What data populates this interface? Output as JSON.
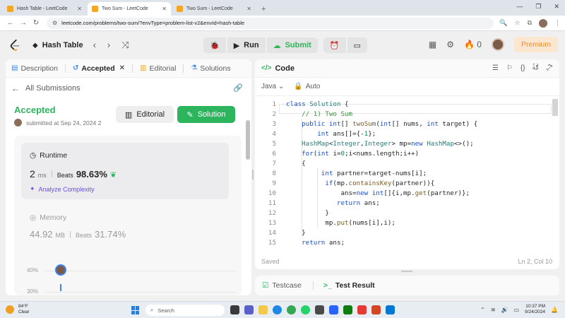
{
  "browser": {
    "tabs": [
      {
        "title": "Hash Table - LeetCode",
        "active": false
      },
      {
        "title": "Two Sum - LeetCode",
        "active": true
      },
      {
        "title": "Two Sum - LeetCode",
        "active": false
      }
    ],
    "url": "leetcode.com/problems/two-sum/?envType=problem-list-v2&envId=hash-table"
  },
  "header": {
    "problem_list": "Hash Table",
    "run_label": "Run",
    "submit_label": "Submit",
    "streak_count": "0",
    "premium_label": "Premium"
  },
  "left_panel": {
    "tabs": [
      {
        "label": "Description"
      },
      {
        "label": "Accepted"
      },
      {
        "label": "Editorial"
      },
      {
        "label": "Solutions"
      }
    ],
    "all_submissions": "All Submissions",
    "status": "Accepted",
    "submitted_at": "submitted at Sep 24, 2024 2",
    "editorial_button": "Editorial",
    "solution_button": "Solution",
    "runtime": {
      "label": "Runtime",
      "value": "2",
      "unit": "ms",
      "beats_label": "Beats",
      "beats": "98.63%",
      "analyze": "Analyze Complexity"
    },
    "memory": {
      "label": "Memory",
      "value": "44.92",
      "unit": "MB",
      "beats_label": "Beats",
      "beats": "31.74%"
    },
    "chart_ticks": [
      "40%",
      "30%"
    ]
  },
  "right_panel": {
    "title": "Code",
    "language": "Java",
    "auto_label": "Auto",
    "status": "Saved",
    "cursor": "Ln 2, Col 10",
    "line_numbers": [
      "1",
      "2",
      "3",
      "4",
      "5",
      "6",
      "7",
      "8",
      "9",
      "10",
      "11",
      "12",
      "13",
      "14",
      "15"
    ],
    "code_lines": [
      "class Solution {",
      "    // 1) Two Sum",
      "    public int[] twoSum(int[] nums, int target) {",
      "        int ans[]={-1};",
      "    HashMap<Integer,Integer> mp=new HashMap<>();",
      "    for(int i=0;i<nums.length;i++)",
      "    {",
      "         int partner=target-nums[i];",
      "          if(mp.containsKey(partner)){",
      "              ans=new int[]{i,mp.get(partner)};",
      "             return ans;",
      "          }",
      "          mp.put(nums[i],i);",
      "    }",
      "    return ans;"
    ]
  },
  "bottom_panel": {
    "testcase_tab": "Testcase",
    "result_tab": "Test Result"
  },
  "taskbar": {
    "temperature": "84°F",
    "condition": "Clear",
    "search_placeholder": "Search",
    "time": "10:37 PM",
    "date": "9/24/2024"
  }
}
